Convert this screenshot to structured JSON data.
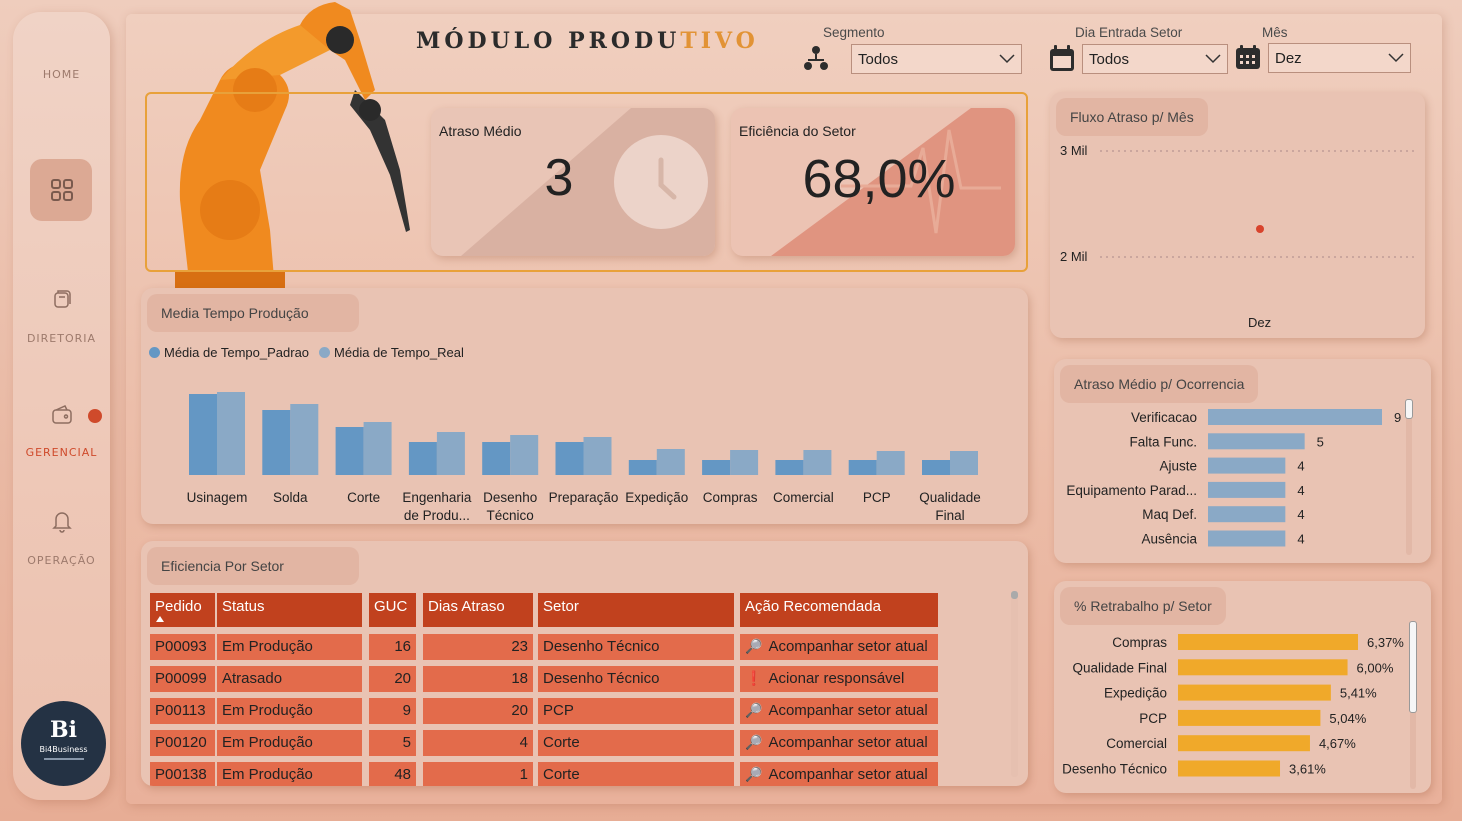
{
  "sidebar": {
    "home": "HOME",
    "diretoria": "DIRETORIA",
    "gerencial": "GERENCIAL",
    "operacao": "OPERAÇÃO",
    "logo_main": "Bi",
    "logo_sub": "Bi4Business",
    "active_dot_color": "#cf4a2b"
  },
  "header": {
    "title_a": "MÓDULO PRODU",
    "title_b": "TIVO"
  },
  "filters": {
    "segmento_label": "Segmento",
    "segmento_value": "Todos",
    "dia_label": "Dia Entrada Setor",
    "dia_value": "Todos",
    "mes_label": "Mês",
    "mes_value": "Dez"
  },
  "kpis": {
    "atraso_label": "Atraso Médio",
    "atraso_value": "3",
    "eficiencia_label": "Eficiência do Setor",
    "eficiencia_value": "68,0%"
  },
  "fluxo": {
    "title": "Fluxo Atraso p/ Mês",
    "y_top": "3 Mil",
    "y_mid": "2 Mil",
    "x_label": "Dez"
  },
  "media_tempo": {
    "title": "Media Tempo Produção",
    "legend_a": "Média de Tempo_Padrao",
    "legend_b": "Média de Tempo_Real"
  },
  "ocorrencia": {
    "title": "Atraso Médio p/  Ocorrencia"
  },
  "retrabalho": {
    "title": "% Retrabalho p/ Setor"
  },
  "eficiencia_setor": {
    "title": "Eficiencia Por Setor",
    "headers": [
      "Pedido",
      "Status",
      "GUC",
      "Dias Atraso",
      "Setor",
      "Ação Recomendada"
    ],
    "rows": [
      [
        "P00093",
        "Em Produção",
        "16",
        "23",
        "Desenho Técnico",
        "Acompanhar setor atual"
      ],
      [
        "P00099",
        "Atrasado",
        "20",
        "18",
        "Desenho Técnico",
        "Acionar responsável"
      ],
      [
        "P00113",
        "Em Produção",
        "9",
        "20",
        "PCP",
        "Acompanhar setor atual"
      ],
      [
        "P00120",
        "Em Produção",
        "5",
        "4",
        "Corte",
        "Acompanhar setor atual"
      ],
      [
        "P00138",
        "Em Produção",
        "48",
        "1",
        "Corte",
        "Acompanhar setor atual"
      ]
    ]
  },
  "chart_data": [
    {
      "type": "bar",
      "categories": [
        "Usinagem",
        "Solda",
        "Corte",
        "Engenharia de Produ...",
        "Desenho Técnico",
        "Preparação",
        "Expedição",
        "Compras",
        "Comercial",
        "PCP",
        "Qualidade Final"
      ],
      "series": [
        {
          "name": "Média de Tempo_Padrao",
          "color": "#6497c4",
          "values": [
            81,
            65,
            48,
            33,
            33,
            33,
            15,
            15,
            15,
            15,
            15
          ]
        },
        {
          "name": "Média de Tempo_Real",
          "color": "#8aa9c6",
          "values": [
            83,
            71,
            53,
            43,
            40,
            38,
            26,
            25,
            25,
            24,
            24
          ]
        }
      ],
      "title": "Media Tempo Produção"
    },
    {
      "type": "bar",
      "orientation": "horizontal",
      "categories": [
        "Verificacao",
        "Falta Func.",
        "Ajuste",
        "Equipamento Parad...",
        "Maq Def.",
        "Ausência"
      ],
      "values": [
        9,
        5,
        4,
        4,
        4,
        4
      ],
      "labels": [
        "9",
        "5",
        "4",
        "4",
        "4",
        "4"
      ],
      "color": "#8aa9c6",
      "title": "Atraso Médio p/  Ocorrencia"
    },
    {
      "type": "bar",
      "orientation": "horizontal",
      "categories": [
        "Compras",
        "Qualidade Final",
        "Expedição",
        "PCP",
        "Comercial",
        "Desenho Técnico"
      ],
      "values": [
        6.37,
        6.0,
        5.41,
        5.04,
        4.67,
        3.61
      ],
      "labels": [
        "6,37%",
        "6,00%",
        "5,41%",
        "5,04%",
        "4,67%",
        "3,61%"
      ],
      "color": "#f0a92a",
      "title": "% Retrabalho p/ Setor"
    },
    {
      "type": "scatter",
      "x": [
        "Dez"
      ],
      "y": [
        2.3
      ],
      "yticks": [
        "2 Mil",
        "3 Mil"
      ],
      "color": "#d8432c",
      "title": "Fluxo Atraso p/ Mês"
    }
  ]
}
